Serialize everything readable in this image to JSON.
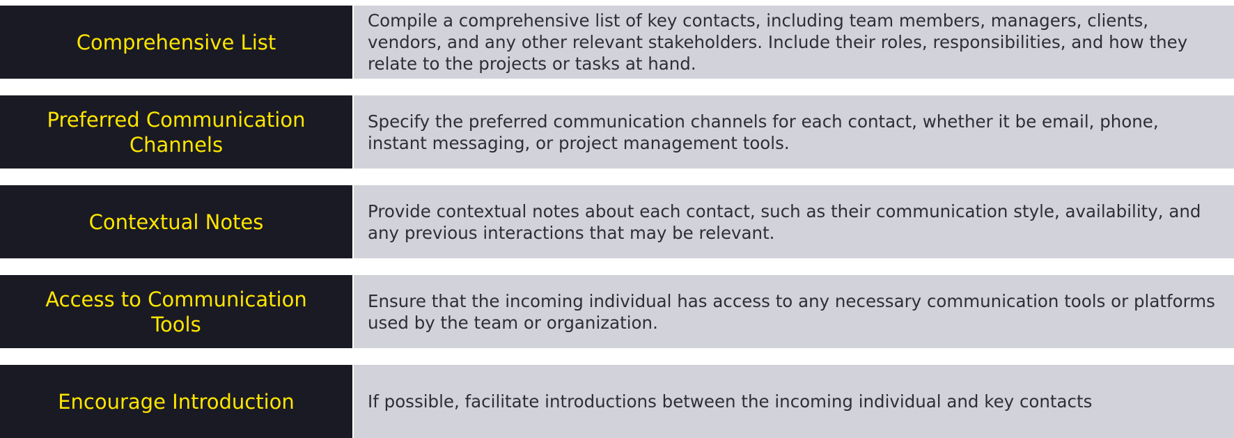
{
  "rows": [
    {
      "label": "Comprehensive List",
      "description": "Compile a comprehensive list of key contacts, including team members, managers, clients, vendors, and any other relevant stakeholders. Include their roles, responsibilities, and how they relate to the projects or tasks at hand."
    },
    {
      "label": "Preferred Communication Channels",
      "description": "Specify the preferred communication channels for each contact, whether it be email, phone, instant messaging, or project management tools."
    },
    {
      "label": "Contextual Notes",
      "description": "Provide contextual notes about each contact, such as their communication style, availability, and any previous interactions that may be relevant."
    },
    {
      "label": "Access to Communication Tools",
      "description": "Ensure that the incoming individual has access to any necessary communication tools or platforms used by the team or organization."
    },
    {
      "label": "Encourage Introduction",
      "description": "If possible, facilitate introductions between the incoming individual and key contacts"
    }
  ]
}
